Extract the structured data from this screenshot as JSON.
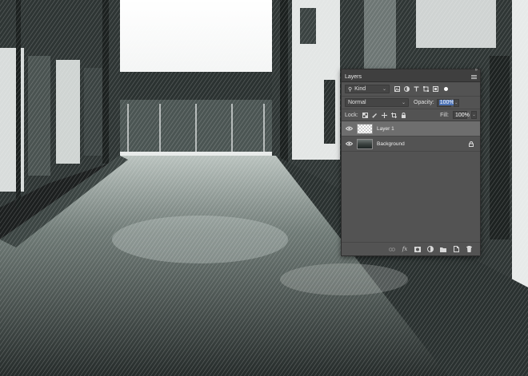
{
  "panel": {
    "title": "Layers",
    "collapse_glyph": "»",
    "filter": {
      "kind_label": "Kind",
      "search_glyph": "⚲"
    },
    "blend_mode": "Normal",
    "opacity_label": "Opacity:",
    "opacity_value": "100%",
    "lock_label": "Lock:",
    "fill_label": "Fill:",
    "fill_value": "100%",
    "layers": [
      {
        "name": "Layer 1",
        "visible": true,
        "selected": true,
        "locked": false
      },
      {
        "name": "Background",
        "visible": true,
        "selected": false,
        "locked": true
      }
    ],
    "footer_icons": [
      "link-icon",
      "fx-icon",
      "mask-icon",
      "adjustment-icon",
      "folder-icon",
      "new-layer-icon",
      "trash-icon"
    ],
    "fx_glyph": "fx"
  },
  "colors": {
    "panel_bg": "#535353",
    "header_bg": "#3f3f3f",
    "selected_layer": "#6e6e6e",
    "opacity_highlight": "#4c73b7"
  }
}
